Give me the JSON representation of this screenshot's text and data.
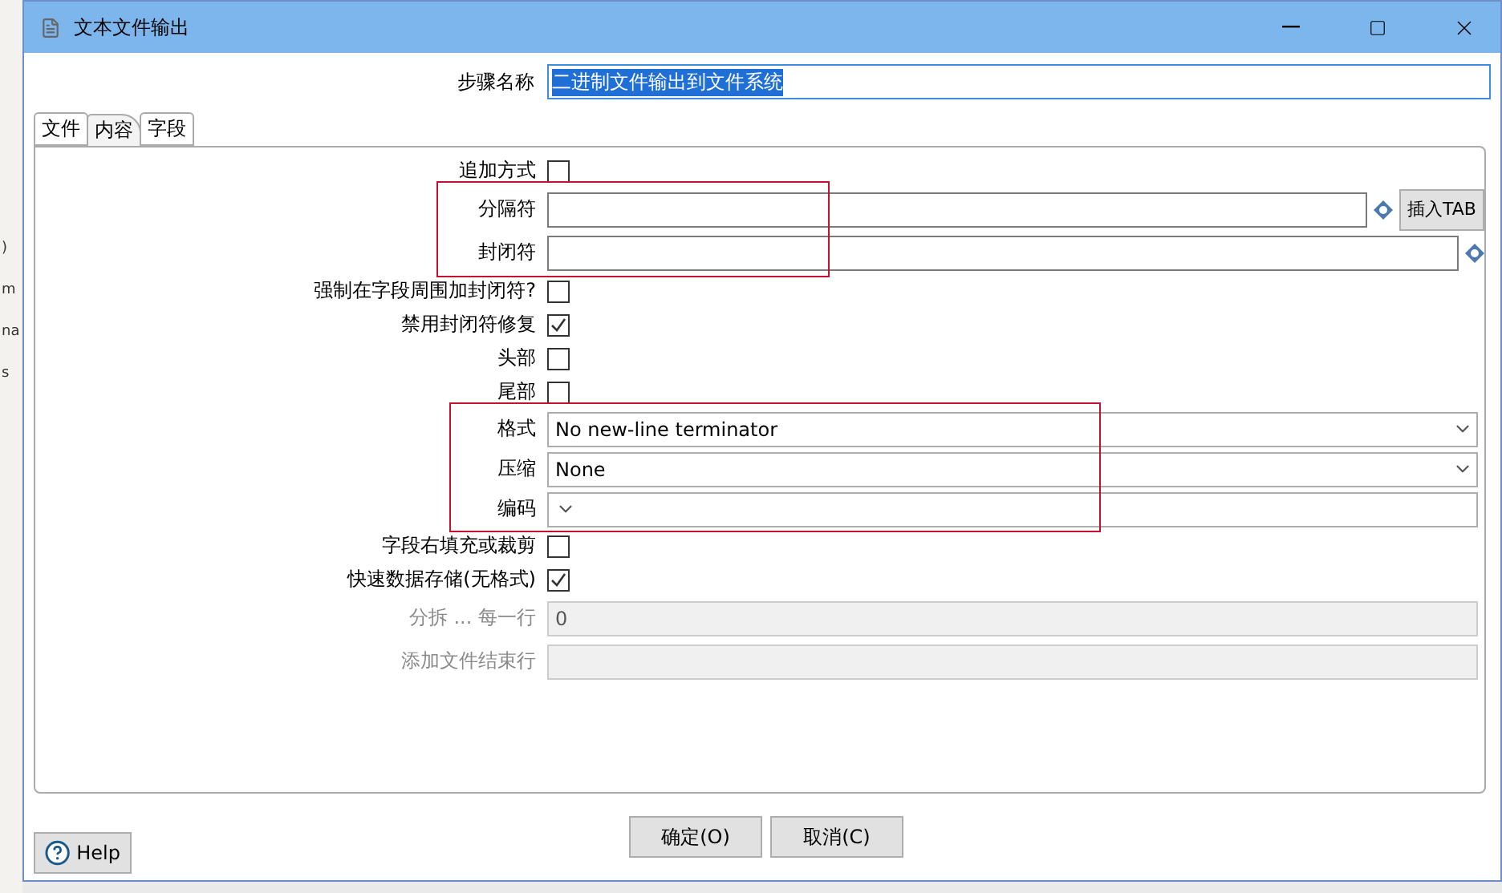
{
  "background_fragments": [
    ")",
    "m",
    "na",
    "s"
  ],
  "window": {
    "title": "文本文件输出"
  },
  "step_name": {
    "label": "步骤名称",
    "value": "二进制文件输出到文件系统"
  },
  "tabs": [
    {
      "label": "文件",
      "selected": false
    },
    {
      "label": "内容",
      "selected": true
    },
    {
      "label": "字段",
      "selected": false
    }
  ],
  "rows": [
    {
      "kind": "checkbox",
      "label": "追加方式",
      "checked": false,
      "highlighted": false
    },
    {
      "kind": "text",
      "label": "分隔符",
      "value": "",
      "variable": true,
      "button": "插入TAB",
      "highlighted": true
    },
    {
      "kind": "text",
      "label": "封闭符",
      "value": "",
      "variable": true,
      "highlighted": true
    },
    {
      "kind": "checkbox",
      "label": "强制在字段周围加封闭符?",
      "checked": false,
      "highlighted": false
    },
    {
      "kind": "checkbox",
      "label": "禁用封闭符修复",
      "checked": true,
      "highlighted": false
    },
    {
      "kind": "checkbox",
      "label": "头部",
      "checked": false,
      "highlighted": false
    },
    {
      "kind": "checkbox",
      "label": "尾部",
      "checked": false,
      "highlighted": false
    },
    {
      "kind": "select",
      "label": "格式",
      "value": "No new-line terminator",
      "highlighted": true
    },
    {
      "kind": "select",
      "label": "压缩",
      "value": "None",
      "highlighted": true
    },
    {
      "kind": "select",
      "label": "编码",
      "value": "",
      "highlighted": true
    },
    {
      "kind": "checkbox",
      "label": "字段右填充或裁剪",
      "checked": false,
      "highlighted": false
    },
    {
      "kind": "checkbox",
      "label": "快速数据存储(无格式)",
      "checked": true,
      "highlighted": false
    },
    {
      "kind": "text",
      "label": "分拆 ... 每一行",
      "value": "0",
      "disabled": true,
      "highlighted": false
    },
    {
      "kind": "text",
      "label": "添加文件结束行",
      "value": "",
      "disabled": true,
      "highlighted": false
    }
  ],
  "help_button": "Help",
  "buttons": [
    "确定(O)",
    "取消(C)"
  ]
}
